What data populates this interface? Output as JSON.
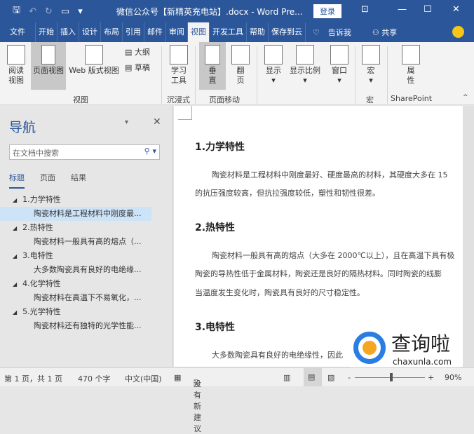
{
  "titlebar": {
    "title": "微信公众号【新精英充电站】.docx - Word Pre...",
    "login": "登录",
    "icons": [
      "save-icon",
      "undo-icon",
      "redo-icon",
      "touch-mode-icon",
      "customize-icon"
    ]
  },
  "tabs": [
    "文件",
    "开始",
    "插入",
    "设计",
    "布局",
    "引用",
    "邮件",
    "审阅",
    "视图",
    "开发工具",
    "帮助",
    "保存到云",
    "告诉我",
    "共享"
  ],
  "active_tab": "视图",
  "ribbon": {
    "read": "阅读视图",
    "print": "页面视图",
    "web": "Web 版式视图",
    "outline": "大纲",
    "draft": "草稿",
    "group_view": "视图",
    "learn": "学习工具",
    "group_immersive": "沉浸式",
    "vertical": "垂直",
    "flip": "翻页",
    "group_move": "页面移动",
    "show": "显示",
    "zoom": "显示比例",
    "window": "窗口",
    "macro": "宏",
    "group_macro": "宏",
    "props": "属性",
    "group_sp": "SharePoint"
  },
  "nav": {
    "title": "导航",
    "search_placeholder": "在文档中搜索",
    "tabs": [
      "标题",
      "页面",
      "结果"
    ],
    "items": [
      {
        "h": "1.力学特性",
        "s": "陶瓷材料是工程材料中刚度最..."
      },
      {
        "h": "2.热特性",
        "s": "陶瓷材料一般具有高的熔点（..."
      },
      {
        "h": "3.电特性",
        "s": "大多数陶瓷具有良好的电绝缘..."
      },
      {
        "h": "4.化学特性",
        "s": "陶瓷材料在高温下不易氧化，..."
      },
      {
        "h": "5.光学特性",
        "s": "陶瓷材料还有独特的光学性能..."
      }
    ]
  },
  "doc": {
    "h1": "1.力学特性",
    "p1a": "陶瓷材料是工程材料中刚度最好、硬度最高的材料，其硬度大多在 15",
    "p1b": "的抗压强度较高，但抗拉强度较低，塑性和韧性很差。",
    "h2": "2.热特性",
    "p2a": "陶瓷材料一般具有高的熔点（大多在 2000℃以上），且在高温下具有极",
    "p2b": "陶瓷的导热性低于金属材料，陶瓷还是良好的隔热材料。同时陶瓷的线膨",
    "p2c": "当温度发生变化时，陶瓷具有良好的尺寸稳定性。",
    "h3": "3.电特性",
    "p3a": "大多数陶瓷具有良好的电绝缘性，因此"
  },
  "status": {
    "page": "第 1 页，共 1 页",
    "words": "470 个字",
    "lang": "中文(中国)",
    "suggest": "没有新建议",
    "zoom": "90%"
  },
  "watermark": {
    "text": "查询啦",
    "url": "chaxunla.com"
  }
}
